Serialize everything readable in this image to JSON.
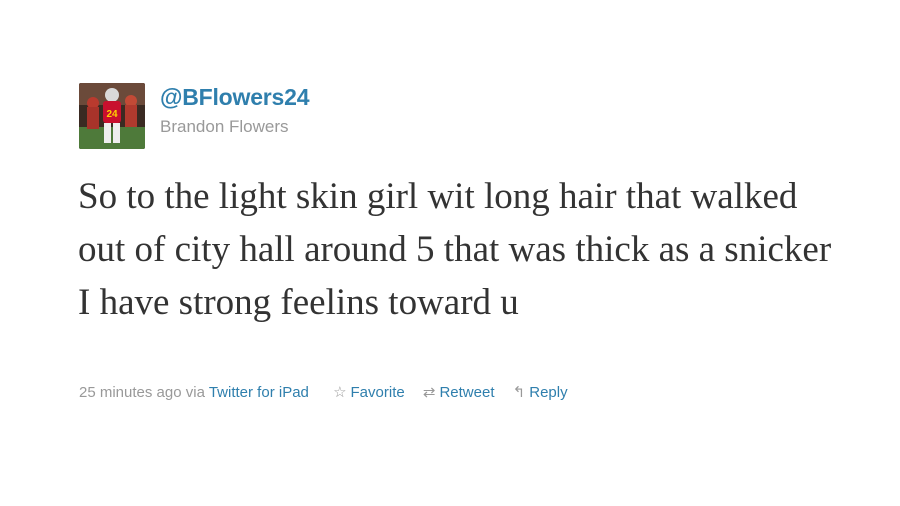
{
  "user": {
    "handle": "@BFlowers24",
    "name": "Brandon Flowers",
    "avatar_jersey_number": "24"
  },
  "tweet": {
    "text": "So to the light skin girl wit long hair that walked out of city hall around 5 that was thick as a snicker I have strong feelins toward u"
  },
  "meta": {
    "time": "25 minutes ago",
    "via_prefix": "via",
    "source": "Twitter for iPad"
  },
  "actions": {
    "favorite": "Favorite",
    "retweet": "Retweet",
    "reply": "Reply"
  },
  "colors": {
    "link": "#2f7fad",
    "text": "#333333",
    "muted": "#999999"
  }
}
